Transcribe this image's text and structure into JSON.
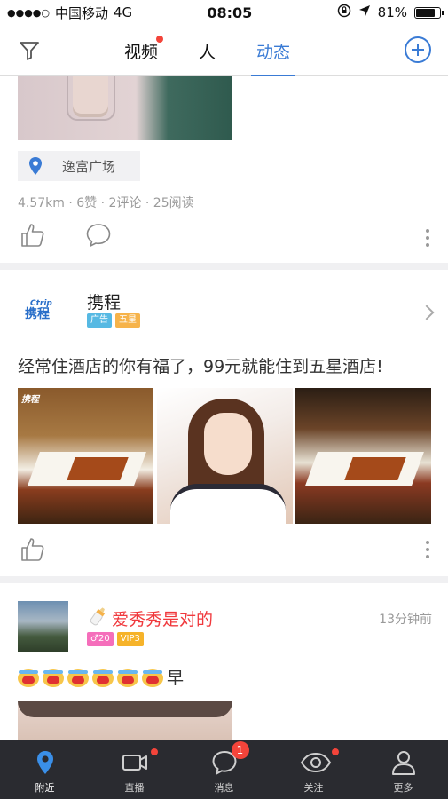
{
  "status_bar": {
    "carrier": "中国移动",
    "network": "4G",
    "time": "08:05",
    "battery": "81%",
    "battery_fraction": 0.81
  },
  "nav": {
    "tabs": [
      {
        "label": "视频",
        "has_dot": true
      },
      {
        "label": "人",
        "has_dot": false
      },
      {
        "label": "动态",
        "active": true
      }
    ]
  },
  "feed": {
    "post1": {
      "location": "逸富广场",
      "meta": "4.57km · 6赞 · 2评论 · 25阅读"
    },
    "ad": {
      "name": "携程",
      "logo_top": "Ctrip",
      "logo_bottom": "携程",
      "badges": [
        "广告",
        "五星"
      ],
      "text": "经常住酒店的你有福了，99元就能住到五星酒店!",
      "watermark": "携程"
    },
    "post2": {
      "username": "爱秀秀是对的",
      "time_ago": "13分钟前",
      "age_badge": "♂20",
      "vip_badge": "VIP3",
      "text_suffix": "早",
      "emoji_count": 6
    }
  },
  "tabbar": {
    "items": [
      {
        "label": "附近",
        "icon": "location-pin-icon",
        "active": true
      },
      {
        "label": "直播",
        "icon": "video-camera-icon",
        "dot": true
      },
      {
        "label": "消息",
        "icon": "chat-bubble-icon",
        "badge": "1"
      },
      {
        "label": "关注",
        "icon": "eye-icon",
        "dot": true
      },
      {
        "label": "更多",
        "icon": "person-icon"
      }
    ]
  },
  "colors": {
    "accent": "#3a7bd5",
    "red": "#f3443a",
    "tabbar_bg": "#2a2b30"
  }
}
